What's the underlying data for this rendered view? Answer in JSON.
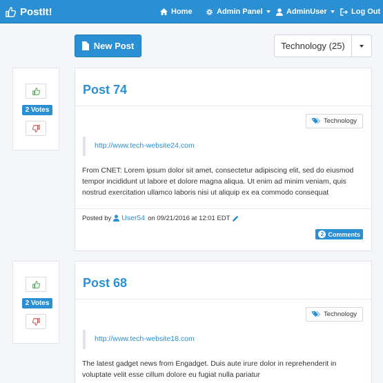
{
  "nav": {
    "brand": "PostIt!",
    "home": "Home",
    "admin_panel": "Admin Panel",
    "user": "AdminUser",
    "logout": "Log Out"
  },
  "toolbar": {
    "new_post": "New Post",
    "category_selected": "Technology (25)"
  },
  "colors": {
    "primary": "#2a8fd3",
    "upvote": "#4caf50",
    "downvote": "#d9534f"
  },
  "posts": [
    {
      "votes": "2 Votes",
      "title": "Post 74",
      "tag": "Technology",
      "link": "http://www.tech-website24.com",
      "body": "From CNET: Lorem ipsum dolor sit amet, consectetur adipiscing elit, sed do eiusmod tempor incididunt ut labore et dolore magna aliqua. Ut enim ad minim veniam, quis nostrud exercitation ullamco laboris nisi ut aliquip ex ea commodo consequat",
      "posted_by_prefix": "Posted by",
      "author": "User54",
      "posted_on": "on 09/21/2016 at 12:01 EDT",
      "comment_count": "2",
      "comments_label": "Comments"
    },
    {
      "votes": "2 Votes",
      "title": "Post 68",
      "tag": "Technology",
      "link": "http://www.tech-website18.com",
      "body": "The latest gadget news from Engadget. Duis aute irure dolor in reprehenderit in voluptate velit esse cillum dolore eu fugiat nulla pariatur"
    }
  ]
}
